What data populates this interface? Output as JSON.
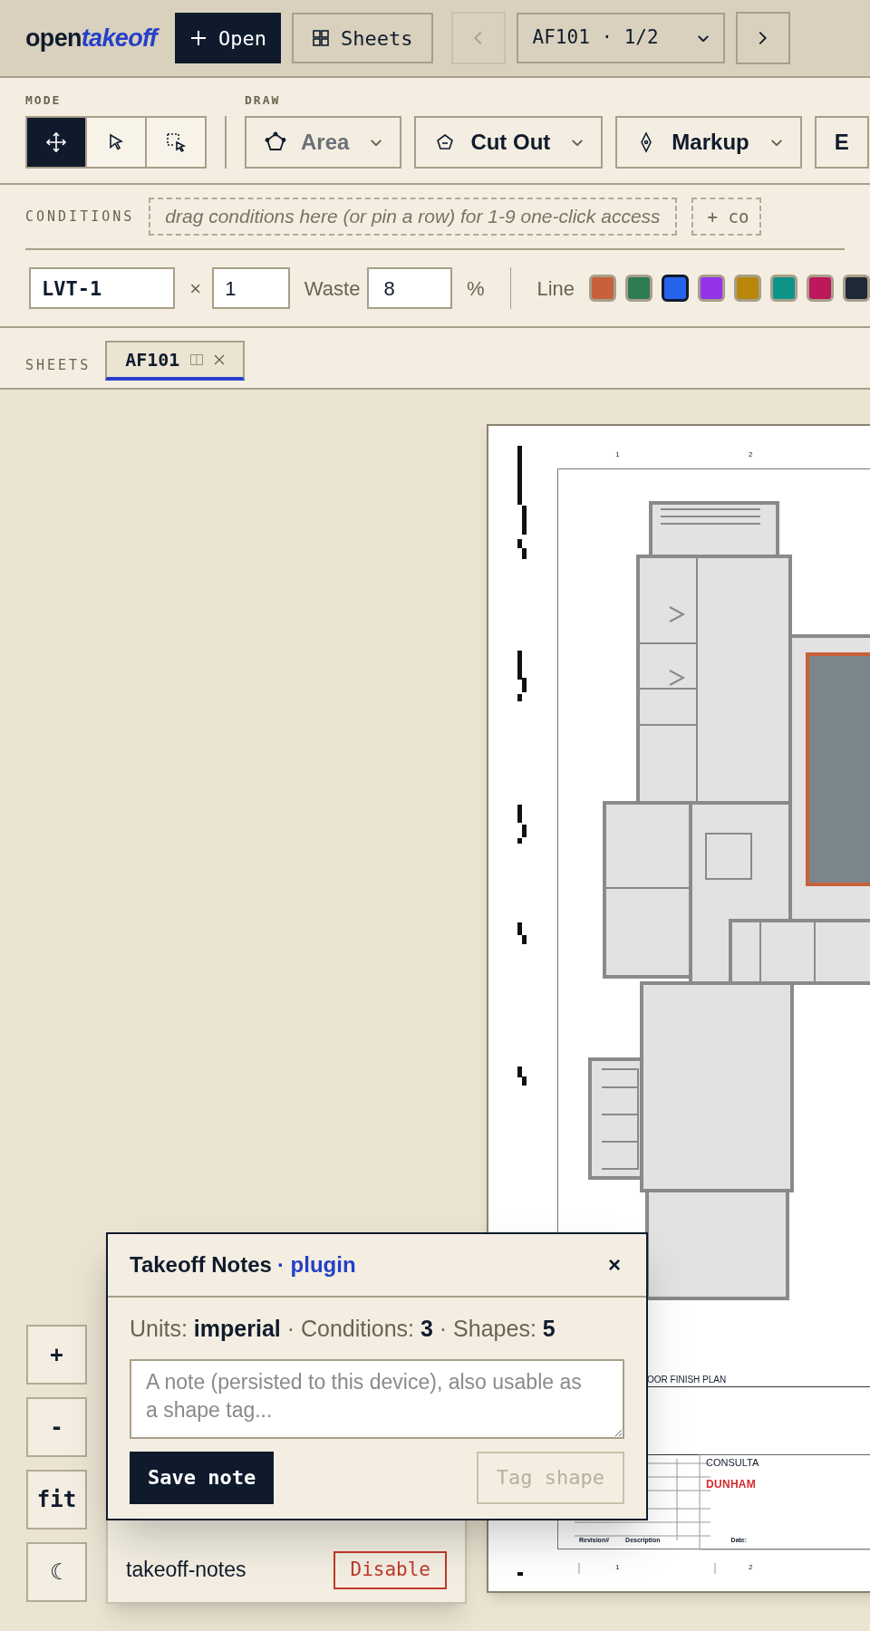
{
  "topbar": {
    "logo": {
      "word": "open",
      "accent": "takeoff"
    },
    "open_button": "Open",
    "sheets_button": "Sheets",
    "prev": {
      "disabled": true
    },
    "page_select": "AF101 · 1/2",
    "next": {
      "disabled": false
    }
  },
  "toolbar": {
    "mode_label": "MODE",
    "modes": [
      {
        "kind": "pan",
        "selected": true
      },
      {
        "kind": "pointer",
        "selected": false
      },
      {
        "kind": "marquee",
        "selected": false
      }
    ],
    "draw_label": "DRAW",
    "draw_tools": [
      {
        "kind": "polygon",
        "label": "Area",
        "disabled": true
      },
      {
        "kind": "pentagon",
        "label": "Cut Out",
        "disabled": false
      },
      {
        "kind": "pen",
        "label": "Markup",
        "disabled": false
      },
      {
        "kind": "none",
        "label": "E",
        "disabled": false
      }
    ]
  },
  "conditions": {
    "label": "CONDITIONS",
    "dropzone": "drag conditions here (or pin a row) for 1-9 one-click access",
    "add_button": "+ co"
  },
  "condition_editor": {
    "name": "LVT-1",
    "times": "×",
    "multiplier": "1",
    "waste_label": "Waste",
    "waste": "8",
    "percent": "%",
    "line_label": "Line",
    "swatches": [
      {
        "color": "#c8603c",
        "selected": false
      },
      {
        "color": "#2e7d52",
        "selected": false
      },
      {
        "color": "#2563eb",
        "selected": true
      },
      {
        "color": "#9333ea",
        "selected": false
      },
      {
        "color": "#b8860b",
        "selected": false
      },
      {
        "color": "#0d9488",
        "selected": false
      },
      {
        "color": "#be185d",
        "selected": false
      },
      {
        "color": "#1f2937",
        "selected": false
      }
    ]
  },
  "sheets": {
    "label": "SHEETS",
    "tabs": [
      {
        "label": "AF101",
        "selected": true
      }
    ]
  },
  "drawing_sheet": {
    "column_labels": [
      "1",
      "2"
    ],
    "bottom_labels": [
      "1",
      "2"
    ],
    "title": "OOR FINISH PLAN",
    "consultant": "CONSULTA",
    "firm": "DUNHAM",
    "revision_headers": [
      "Revision#",
      "Description",
      "Date:"
    ]
  },
  "zoom_controls": [
    "+",
    "-",
    "fit",
    "☾"
  ],
  "plugins": [
    {
      "name": "takeoff-notes",
      "action": "Disable"
    }
  ],
  "notes_dialog": {
    "title": "Takeoff Notes",
    "tag": "· plugin",
    "close": "×",
    "stats": "Units: **imperial** · Conditions: **3** · Shapes: **5**",
    "placeholder": "A note (persisted to this device), also usable as a shape tag...",
    "save_button": "Save note",
    "tag_button": {
      "label": "Tag shape",
      "disabled": true
    }
  }
}
